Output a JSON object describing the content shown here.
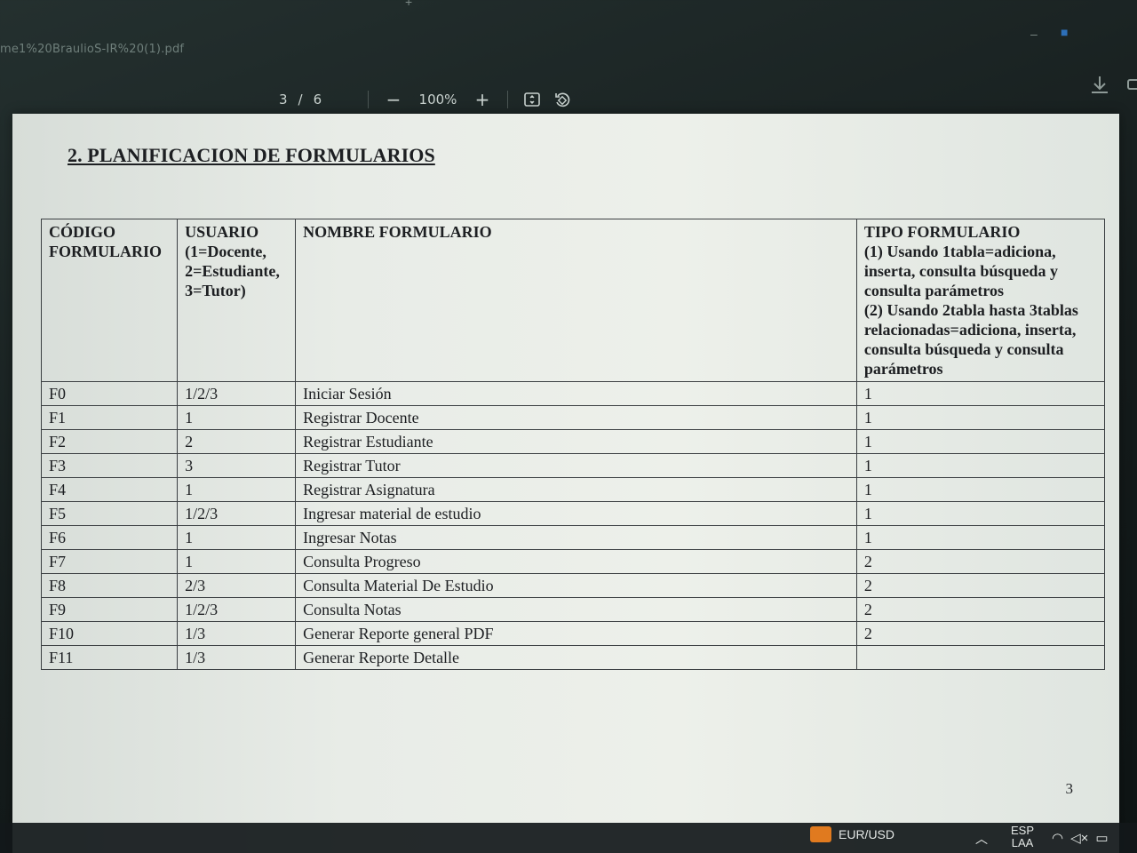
{
  "window": {
    "tab_title": "me1%20BraulioS-IR%20(1).pdf"
  },
  "viewer": {
    "current_page": "3",
    "page_separator": "/",
    "total_pages": "6",
    "zoom_out_label": "−",
    "zoom_level": "100%",
    "zoom_in_label": "+"
  },
  "document": {
    "heading": "2. PLANIFICACION DE FORMULARIOS",
    "page_number": "3",
    "table": {
      "headers": {
        "code": "CÓDIGO FORMULARIO",
        "user": "USUARIO (1=Docente, 2=Estudiante, 3=Tutor)",
        "name": "NOMBRE FORMULARIO",
        "type_title": "TIPO FORMULARIO",
        "type_desc_1": "(1) Usando 1tabla=adiciona, inserta, consulta búsqueda y consulta parámetros",
        "type_desc_2": "(2) Usando 2tabla hasta 3tablas relacionadas=adiciona, inserta, consulta búsqueda y consulta parámetros"
      },
      "rows": [
        {
          "code": "F0",
          "user": "1/2/3",
          "name": "Iniciar Sesión",
          "type": "1"
        },
        {
          "code": "F1",
          "user": "1",
          "name": "Registrar Docente",
          "type": "1"
        },
        {
          "code": "F2",
          "user": "2",
          "name": "Registrar Estudiante",
          "type": "1"
        },
        {
          "code": "F3",
          "user": "3",
          "name": "Registrar Tutor",
          "type": "1"
        },
        {
          "code": "F4",
          "user": "1",
          "name": "Registrar Asignatura",
          "type": "1"
        },
        {
          "code": "F5",
          "user": "1/2/3",
          "name": "Ingresar material de estudio",
          "type": "1"
        },
        {
          "code": "F6",
          "user": "1",
          "name": "Ingresar Notas",
          "type": "1"
        },
        {
          "code": "F7",
          "user": "1",
          "name": "Consulta Progreso",
          "type": "2"
        },
        {
          "code": "F8",
          "user": "2/3",
          "name": "Consulta Material De Estudio",
          "type": "2"
        },
        {
          "code": "F9",
          "user": "1/2/3",
          "name": "Consulta Notas",
          "type": "2"
        },
        {
          "code": "F10",
          "user": "1/3",
          "name": "Generar Reporte general PDF",
          "type": "2"
        },
        {
          "code": "F11",
          "user": "1/3",
          "name": "Generar Reporte Detalle",
          "type": ""
        }
      ]
    }
  },
  "taskbar": {
    "widget_label": "EUR/USD",
    "language_top": "ESP",
    "language_bottom": "LAA"
  },
  "colors": {
    "page": "#edf0ea",
    "ink": "#1d1f22",
    "toolbar_bg": "#151c1c",
    "toolbar_text": "#c9d2cf",
    "widget_accent": "#e07a1f"
  }
}
